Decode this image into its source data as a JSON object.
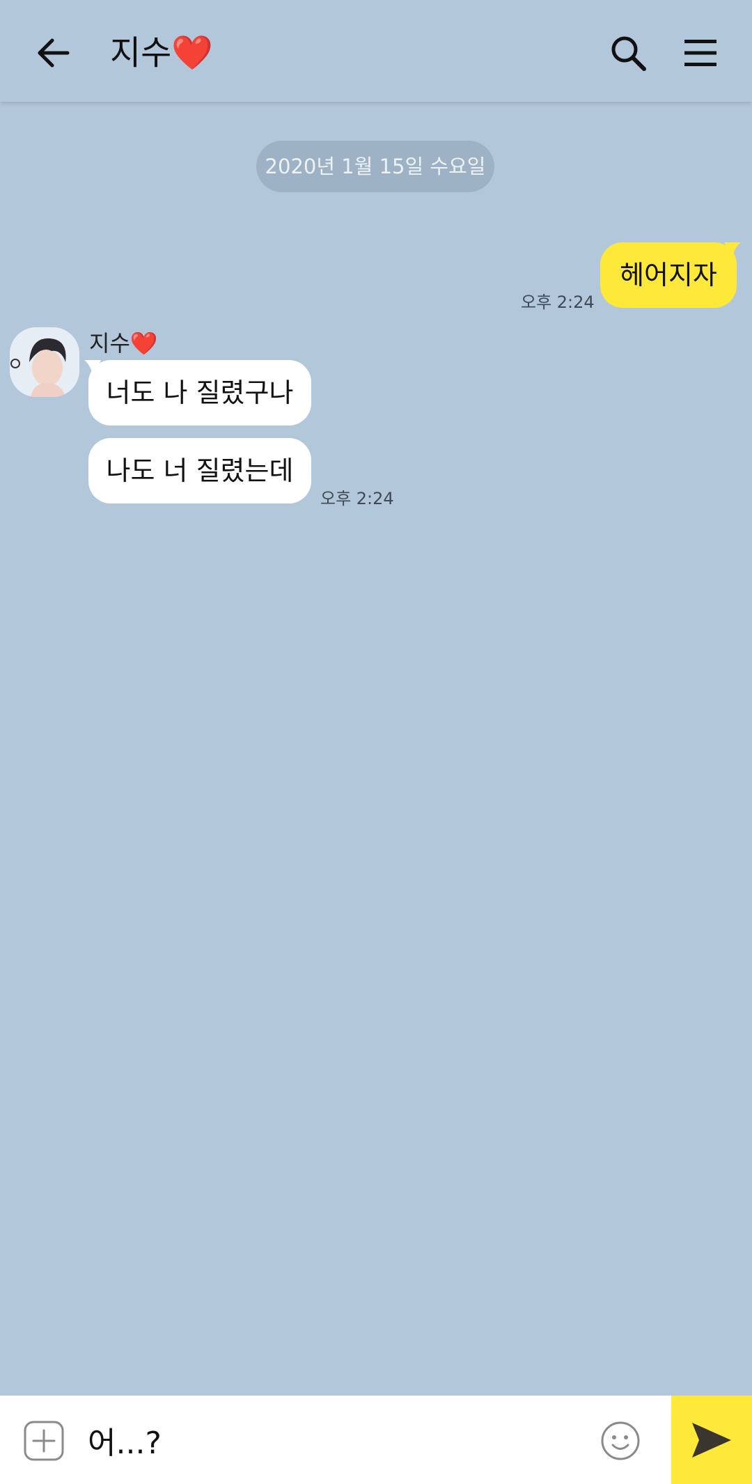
{
  "header": {
    "title": "지수❤️",
    "back_icon": "arrow-left-icon",
    "search_icon": "search-icon",
    "menu_icon": "hamburger-menu-icon"
  },
  "chat": {
    "date_divider": "2020년 1월 15일 수요일",
    "messages": [
      {
        "side": "me",
        "text": "헤어지자",
        "time": "오후 2:24"
      },
      {
        "side": "other",
        "sender": "지수❤️",
        "text": "너도 나 질렸구나"
      },
      {
        "side": "other",
        "text": "나도 너 질렸는데",
        "time": "오후 2:24"
      }
    ]
  },
  "input": {
    "value": "어...?",
    "plus_icon": "plus-square-icon",
    "emoji_icon": "smiley-icon",
    "send_icon": "send-arrow-icon"
  },
  "colors": {
    "background": "#b2c7da",
    "my_bubble": "#fee93b",
    "their_bubble": "#ffffff",
    "send_button": "#fee93b"
  }
}
